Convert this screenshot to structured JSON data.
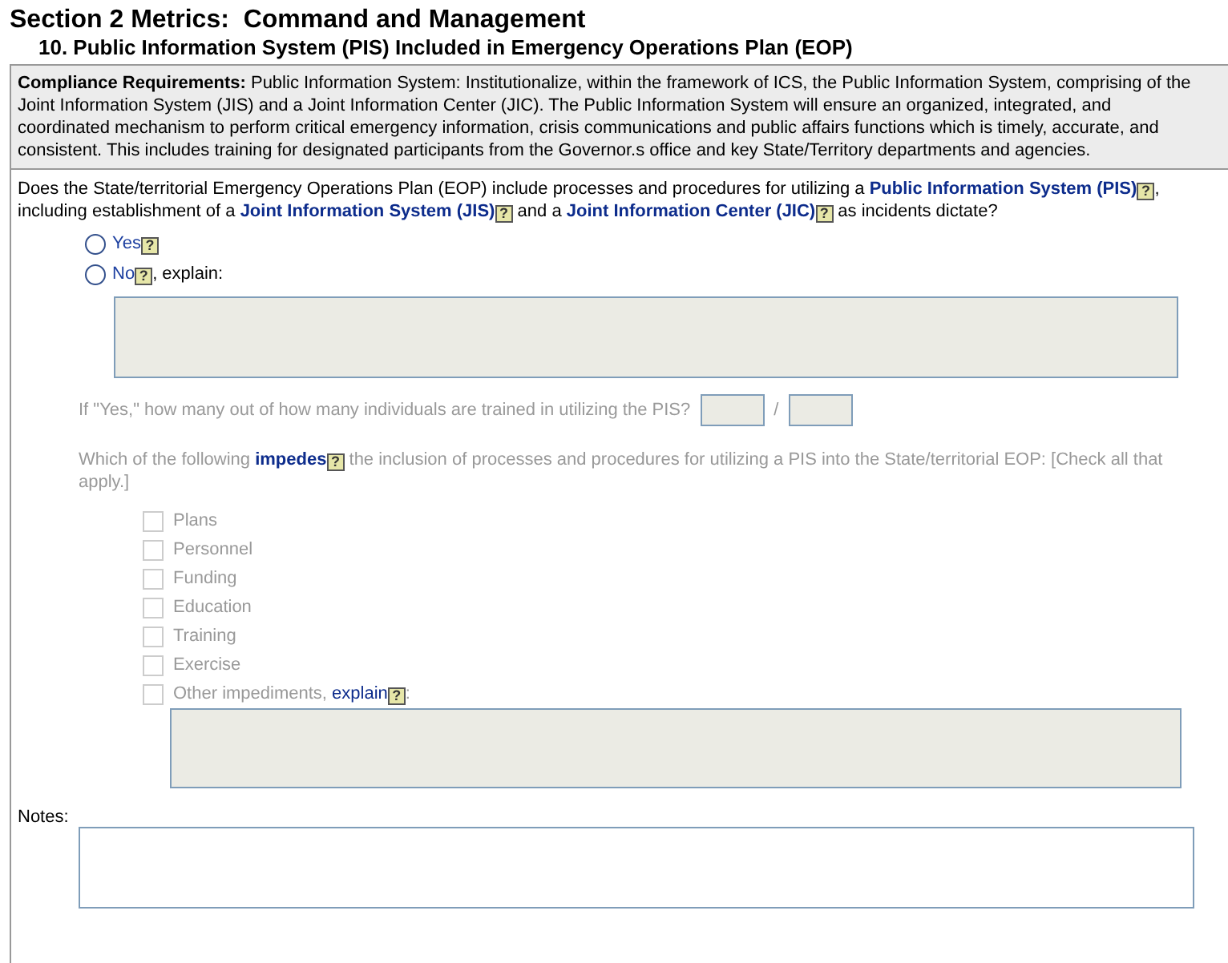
{
  "section_title": "Section 2 Metrics:  Command and Management",
  "question_title": "10. Public Information System (PIS) Included in Emergency Operations Plan (EOP)",
  "compliance": "**Compliance Requirements:** Public Information System: Institutionalize, within the framework of ICS, the Public Information System, comprising of the Joint Information System (JIS) and a Joint Information Center (JIC). The Public Information System will ensure an organized, integrated, and coordinated mechanism to perform critical emergency information, crisis communications and public affairs functions which is timely, accurate, and consistent. This includes training for designated participants from the Governor.s office and key State/Territory departments and agencies.",
  "question": [
    {
      "kind": "text",
      "text": "Does the State/territorial Emergency Operations Plan (EOP) include processes and procedures for utilizing a "
    },
    {
      "kind": "link",
      "text": "Public Information System (PIS)",
      "help": "?"
    },
    {
      "kind": "text",
      "text": ", including establishment of a "
    },
    {
      "kind": "link",
      "text": "Joint Information System (JIS)",
      "help": "?"
    },
    {
      "kind": "text",
      "text": " and a "
    },
    {
      "kind": "link",
      "text": "Joint Information Center (JIC)",
      "help": "?"
    },
    {
      "kind": "text",
      "text": " as incidents dictate?"
    }
  ],
  "answers": [
    {
      "label": "Yes",
      "help": "?",
      "selected": false
    },
    {
      "label": "No",
      "help": "?",
      "suffix": ", explain:",
      "selected": false
    }
  ],
  "explain_box": {
    "disabled": true
  },
  "followup": {
    "disabled": true,
    "training_prompt": "If \"Yes,\" how many out of how many individuals are trained in utilizing the PIS?",
    "separator": "/",
    "impedes_question": [
      {
        "kind": "text",
        "text": "Which of the following "
      },
      {
        "kind": "link",
        "text": "impedes",
        "help": "?"
      },
      {
        "kind": "text",
        "text": " the inclusion of processes and procedures for utilizing a PIS into the State/territorial EOP: [Check all that apply.]"
      }
    ],
    "impediments": [
      {
        "label": "Plans",
        "checked": false
      },
      {
        "label": "Personnel",
        "checked": false
      },
      {
        "label": "Funding",
        "checked": false
      },
      {
        "label": "Education",
        "checked": false
      },
      {
        "label": "Training",
        "checked": false
      },
      {
        "label": "Exercise",
        "checked": false
      },
      {
        "label": "Other impediments, ",
        "link": "explain",
        "help": "?",
        "suffix": ":",
        "checked": false
      }
    ]
  },
  "notes_label": "Notes:"
}
